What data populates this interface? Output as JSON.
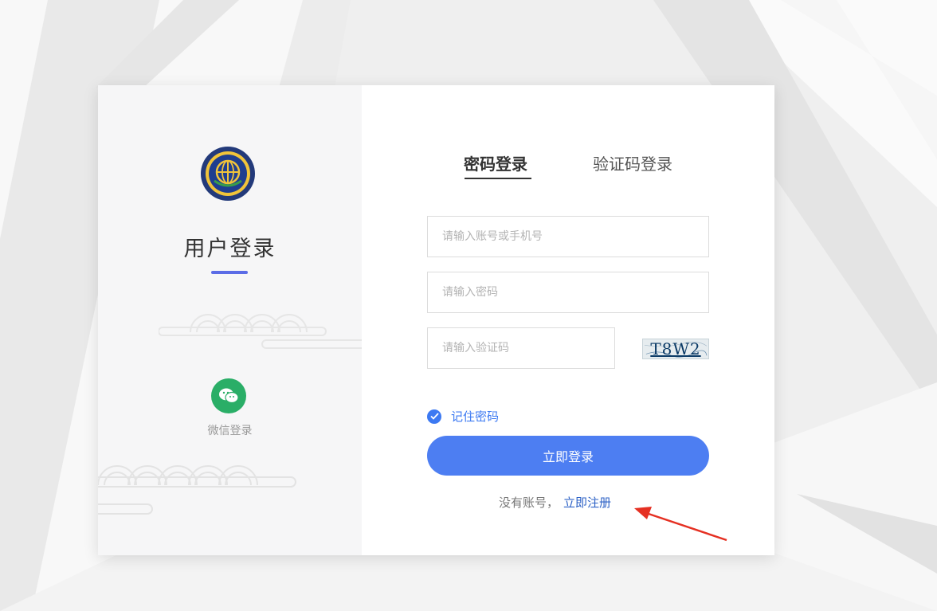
{
  "left_panel": {
    "title": "用户登录",
    "wechat_label": "微信登录"
  },
  "tabs": [
    {
      "label": "密码登录",
      "active": true
    },
    {
      "label": "验证码登录",
      "active": false
    }
  ],
  "form": {
    "account_placeholder": "请输入账号或手机号",
    "account_value": "",
    "password_placeholder": "请输入密码",
    "password_value": "",
    "captcha_placeholder": "请输入验证码",
    "captcha_value": "",
    "captcha_image_text": "T8W2",
    "remember_label": "记住密码",
    "remember_checked": true,
    "login_button": "立即登录"
  },
  "register": {
    "prompt": "没有账号，",
    "link": "立即注册"
  },
  "colors": {
    "accent": "#4d7ef2",
    "link": "#2d62c6",
    "title_bar": "#5b6ce6",
    "wechat": "#2aae67",
    "arrow": "#e53022"
  },
  "icons": [
    "emblem-logo",
    "wechat-icon",
    "check-icon",
    "annotation-arrow"
  ]
}
